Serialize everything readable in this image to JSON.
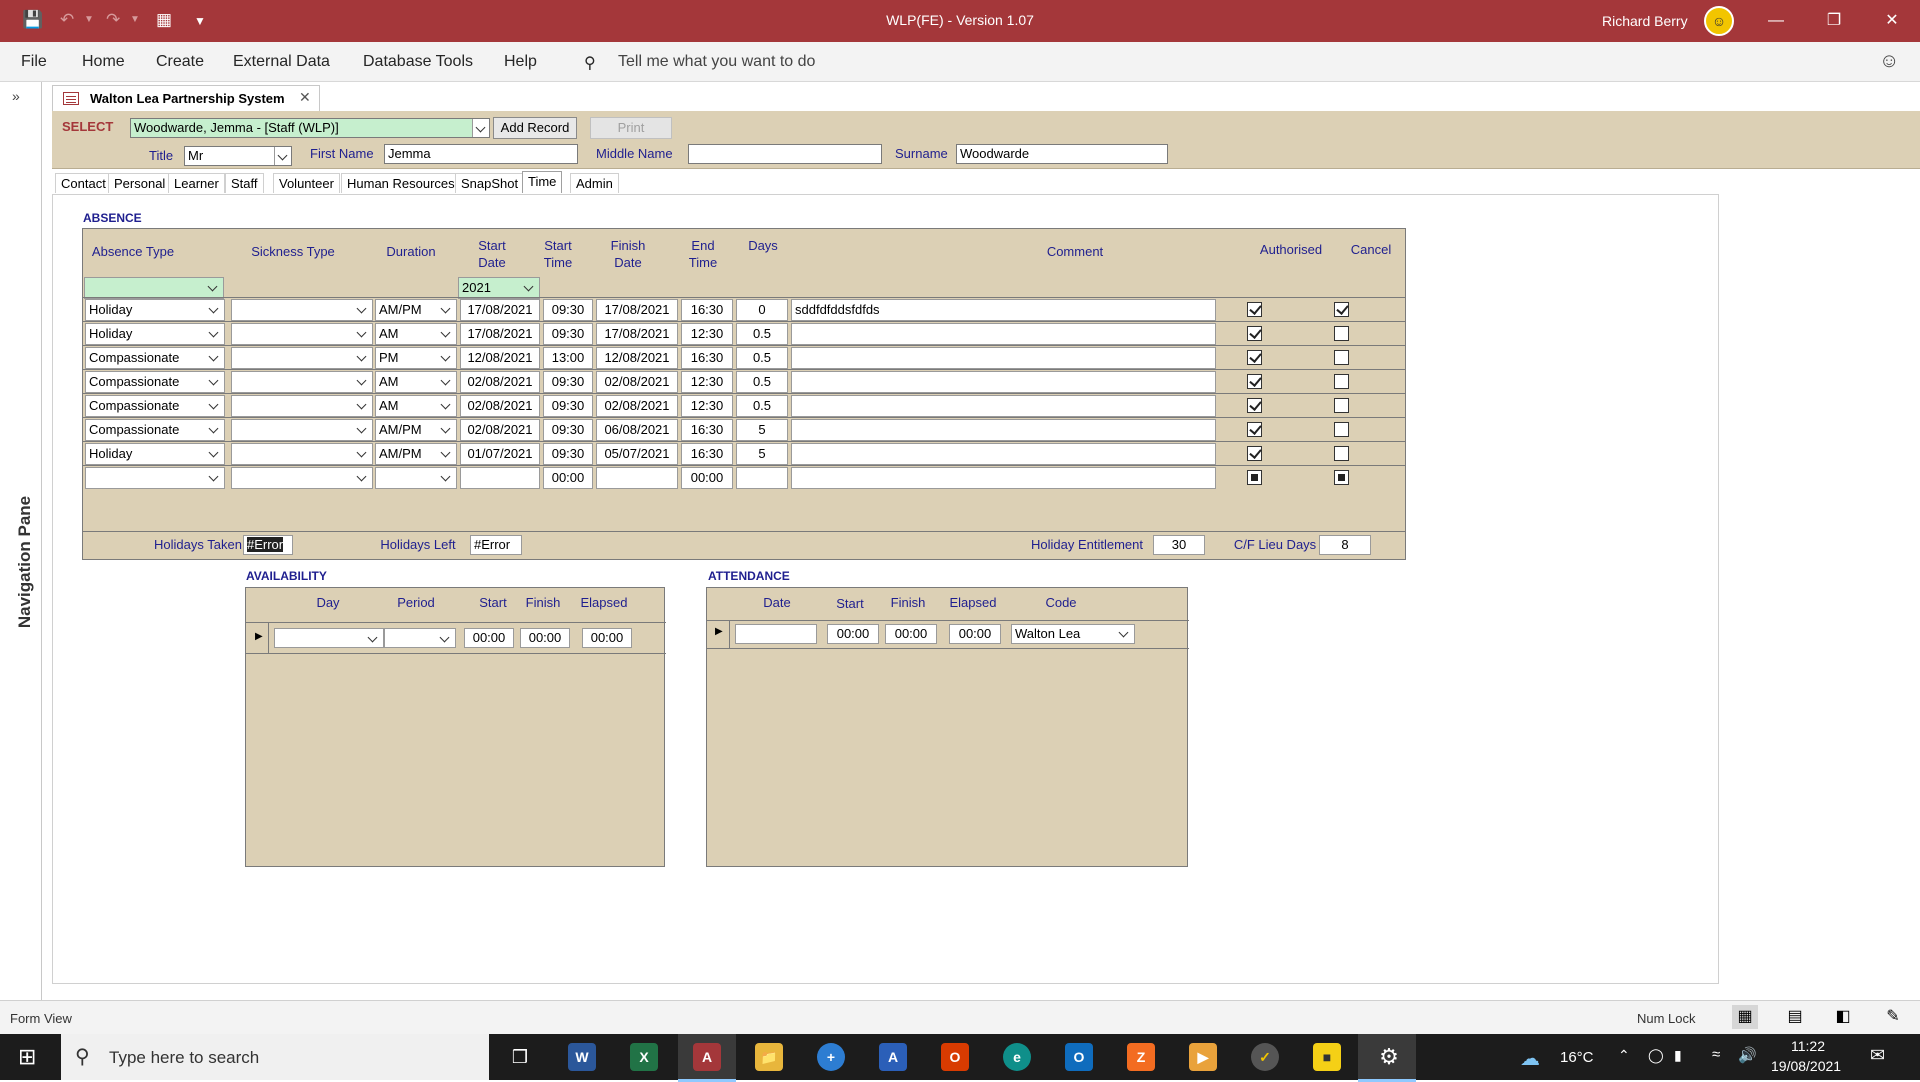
{
  "window": {
    "title": "WLP(FE) - Version 1.07",
    "user": "Richard Berry"
  },
  "ribbon": {
    "tabs": [
      "File",
      "Home",
      "Create",
      "External Data",
      "Database Tools",
      "Help"
    ],
    "tell_me": "Tell me what you want to do"
  },
  "nav_pane": {
    "label": "Navigation Pane"
  },
  "document_tab": {
    "label": "Walton Lea Partnership System"
  },
  "header": {
    "select_label": "SELECT",
    "select_value": "Woodwarde, Jemma - [Staff (WLP)]",
    "add_record": "Add Record",
    "print": "Print",
    "title_label": "Title",
    "title_value": "Mr",
    "first_name_label": "First Name",
    "first_name_value": "Jemma",
    "middle_name_label": "Middle Name",
    "middle_name_value": "",
    "surname_label": "Surname",
    "surname_value": "Woodwarde"
  },
  "page_tabs": [
    "Contact",
    "Personal",
    "Learner",
    "Staff",
    "Volunteer",
    "Human Resources",
    "SnapShot",
    "Time",
    "Admin"
  ],
  "active_tab": "Time",
  "absence": {
    "title": "ABSENCE",
    "columns": {
      "absence_type": "Absence Type",
      "sickness_type": "Sickness Type",
      "duration": "Duration",
      "start_date_1": "Start",
      "start_date_2": "Date",
      "start_time_1": "Start",
      "start_time_2": "Time",
      "finish_date_1": "Finish",
      "finish_date_2": "Date",
      "end_time_1": "End",
      "end_time_2": "Time",
      "days": "Days",
      "comment": "Comment",
      "authorised": "Authorised",
      "cancel": "Cancel"
    },
    "year_filter": "2021",
    "rows": [
      {
        "type": "Holiday",
        "sickness": "",
        "duration": "AM/PM",
        "start_date": "17/08/2021",
        "start_time": "09:30",
        "finish_date": "17/08/2021",
        "end_time": "16:30",
        "days": "0",
        "comment": "sddfdfddsfdfds",
        "authorised": true,
        "cancel": true
      },
      {
        "type": "Holiday",
        "sickness": "",
        "duration": "AM",
        "start_date": "17/08/2021",
        "start_time": "09:30",
        "finish_date": "17/08/2021",
        "end_time": "12:30",
        "days": "0.5",
        "comment": "",
        "authorised": true,
        "cancel": false
      },
      {
        "type": "Compassionate",
        "sickness": "",
        "duration": "PM",
        "start_date": "12/08/2021",
        "start_time": "13:00",
        "finish_date": "12/08/2021",
        "end_time": "16:30",
        "days": "0.5",
        "comment": "",
        "authorised": true,
        "cancel": false
      },
      {
        "type": "Compassionate",
        "sickness": "",
        "duration": "AM",
        "start_date": "02/08/2021",
        "start_time": "09:30",
        "finish_date": "02/08/2021",
        "end_time": "12:30",
        "days": "0.5",
        "comment": "",
        "authorised": true,
        "cancel": false
      },
      {
        "type": "Compassionate",
        "sickness": "",
        "duration": "AM",
        "start_date": "02/08/2021",
        "start_time": "09:30",
        "finish_date": "02/08/2021",
        "end_time": "12:30",
        "days": "0.5",
        "comment": "",
        "authorised": true,
        "cancel": false
      },
      {
        "type": "Compassionate",
        "sickness": "",
        "duration": "AM/PM",
        "start_date": "02/08/2021",
        "start_time": "09:30",
        "finish_date": "06/08/2021",
        "end_time": "16:30",
        "days": "5",
        "comment": "",
        "authorised": true,
        "cancel": false
      },
      {
        "type": "Holiday",
        "sickness": "",
        "duration": "AM/PM",
        "start_date": "01/07/2021",
        "start_time": "09:30",
        "finish_date": "05/07/2021",
        "end_time": "16:30",
        "days": "5",
        "comment": "",
        "authorised": true,
        "cancel": false
      }
    ],
    "new_row": {
      "start_time": "00:00",
      "end_time": "00:00"
    },
    "footer": {
      "holidays_taken_label": "Holidays Taken",
      "holidays_taken_value": "#Error",
      "holidays_left_label": "Holidays Left",
      "holidays_left_value": "#Error",
      "entitlement_label": "Holiday Entitlement",
      "entitlement_value": "30",
      "lieu_label": "C/F Lieu Days",
      "lieu_value": "8"
    }
  },
  "availability": {
    "title": "AVAILABILITY",
    "columns": {
      "day": "Day",
      "period": "Period",
      "start": "Start",
      "finish": "Finish",
      "elapsed": "Elapsed"
    },
    "row": {
      "start": "00:00",
      "finish": "00:00",
      "elapsed": "00:00"
    }
  },
  "attendance": {
    "title": "ATTENDANCE",
    "columns": {
      "date": "Date",
      "start": "Start",
      "finish": "Finish",
      "elapsed": "Elapsed",
      "code": "Code"
    },
    "row": {
      "date": "",
      "start": "00:00",
      "finish": "00:00",
      "elapsed": "00:00",
      "code": "Walton Lea"
    }
  },
  "status_bar": {
    "left": "Form View",
    "num_lock": "Num Lock"
  },
  "taskbar": {
    "search": "Type here to search",
    "temperature": "16°C",
    "time": "11:22",
    "date": "19/08/2021"
  }
}
